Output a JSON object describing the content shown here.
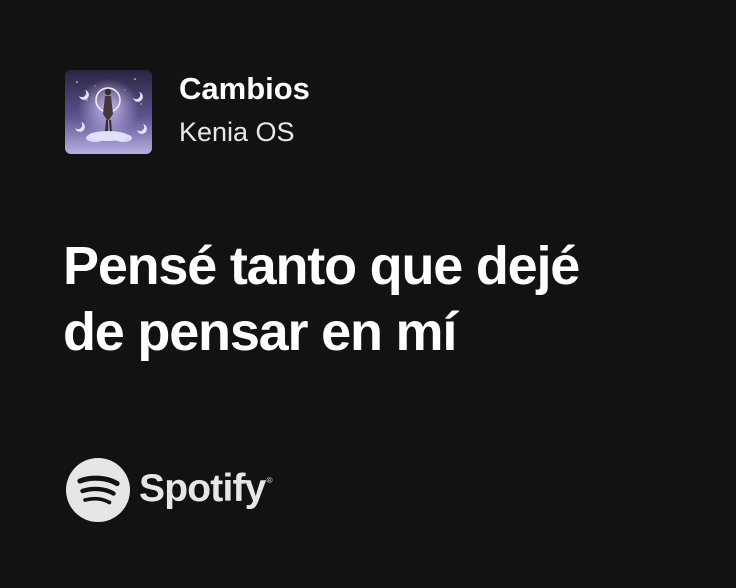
{
  "track": {
    "title": "Cambios",
    "artist": "Kenia OS",
    "cover_icon": "album-cover-image"
  },
  "lyrics": {
    "lines": [
      "Pensé tanto que dejé",
      "de pensar en mí"
    ]
  },
  "brand": {
    "name": "Spotify",
    "trademark": "®",
    "logo_icon": "spotify-logo-icon"
  },
  "colors": {
    "background": "#121212",
    "text": "#ffffff",
    "logo": "#e6e6e6"
  }
}
